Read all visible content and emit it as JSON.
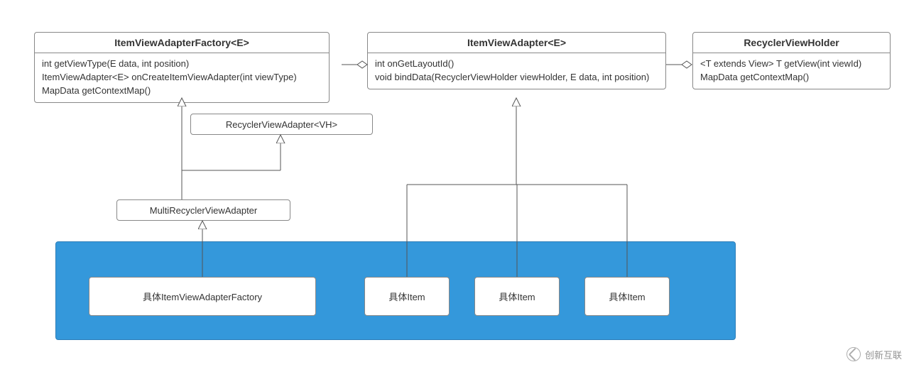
{
  "classes": {
    "factory": {
      "title": "ItemViewAdapterFactory<E>",
      "methods": "int getViewType(E data, int position)\nItemViewAdapter<E> onCreateItemViewAdapter(int viewType)\nMapData getContextMap()"
    },
    "adapter": {
      "title": "ItemViewAdapter<E>",
      "methods": "int onGetLayoutId()\nvoid bindData(RecyclerViewHolder viewHolder, E data, int position)"
    },
    "holder": {
      "title": "RecyclerViewHolder",
      "methods": "<T extends View> T getView(int viewId)\nMapData getContextMap()"
    },
    "rvAdapter": {
      "title": "RecyclerViewAdapter<VH>"
    },
    "multi": {
      "title": "MultiRecyclerViewAdapter"
    },
    "concreteFactory": {
      "title": "具体ItemViewAdapterFactory"
    },
    "item1": {
      "title": "具体Item"
    },
    "item2": {
      "title": "具体Item"
    },
    "item3": {
      "title": "具体Item"
    }
  },
  "watermark": {
    "text": "创新互联"
  }
}
